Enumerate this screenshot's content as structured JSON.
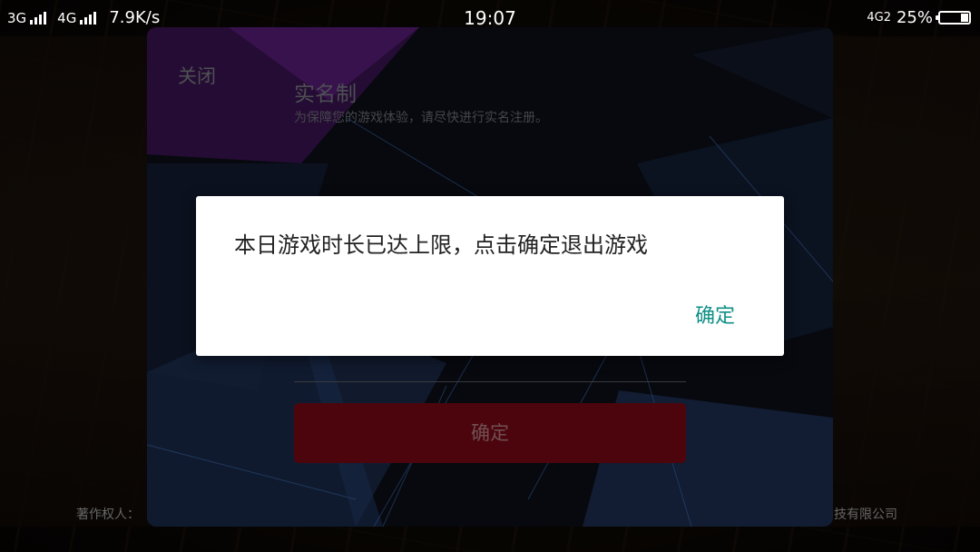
{
  "status_bar": {
    "net1": "3G",
    "net2": "4G",
    "speed": "7.9K/s",
    "time": "19:07",
    "net_right": "4G2",
    "battery": "25%"
  },
  "background": {
    "copyright_left": "著作权人：",
    "copyright_right": "技有限公司"
  },
  "panel": {
    "close_label": "关闭",
    "title": "实名制",
    "subtitle": "为保障您的游戏体验，请尽快进行实名注册。",
    "confirm_label": "确定"
  },
  "dialog": {
    "message": "本日游戏时长已达上限，点击确定退出游戏",
    "ok_label": "确定",
    "ok_color": "#0f8f86"
  },
  "colors": {
    "panel_button": "#6a0811",
    "dialog_bg": "#ffffff"
  }
}
